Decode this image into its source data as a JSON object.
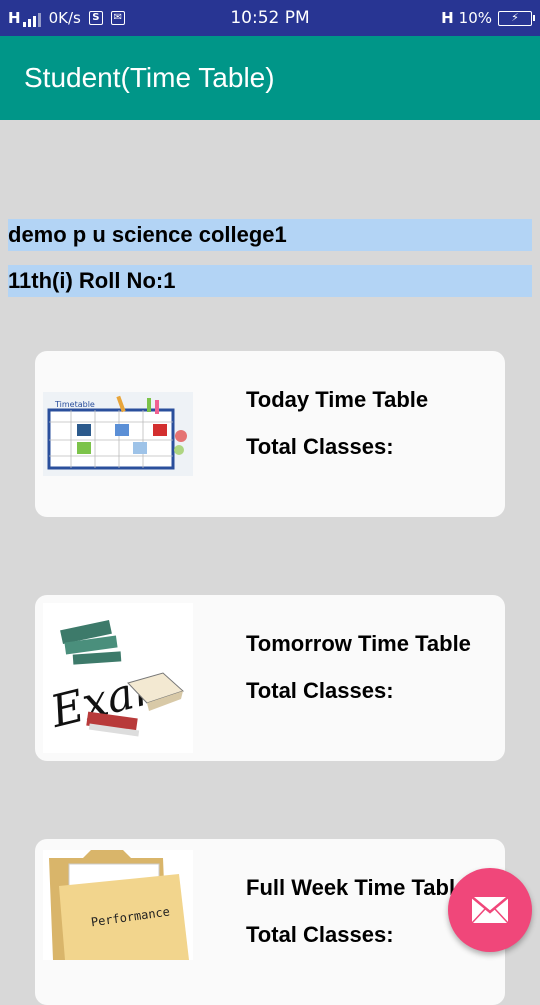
{
  "status_bar": {
    "network_speed": "0K/s",
    "time": "10:52 PM",
    "network_type": "H",
    "battery": "10%"
  },
  "app_bar": {
    "title": "Student(Time Table)"
  },
  "info": {
    "college": "demo p u science college1",
    "class_roll": "11th(i) Roll No:1"
  },
  "cards": [
    {
      "title": "Today Time Table",
      "subtitle": "Total Classes:",
      "icon": "timetable-image"
    },
    {
      "title": "Tomorrow Time Table",
      "subtitle": "Total Classes:",
      "icon": "exam-image"
    },
    {
      "title": "Full Week Time Table",
      "subtitle": "Total Classes:",
      "icon": "performance-folder-image"
    }
  ],
  "images": {
    "timetable_label": "Timetable",
    "folder_label": "Performance",
    "exam_label": "Exam"
  },
  "fab": {
    "icon": "mail-icon"
  },
  "colors": {
    "status_bar": "#283593",
    "app_bar": "#009688",
    "info_highlight": "#b3d4f5",
    "fab": "#f0477a",
    "background": "#d8d8d8"
  }
}
